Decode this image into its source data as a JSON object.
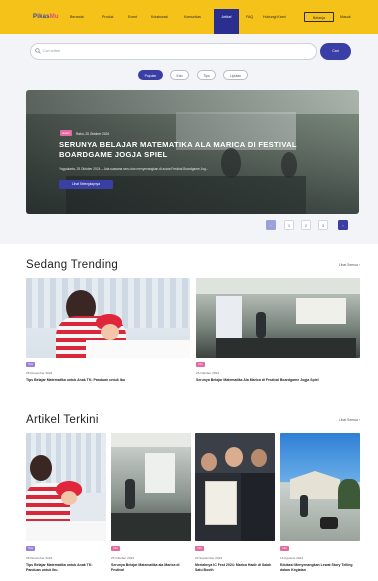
{
  "navbar": {
    "logo_a": "Pikas",
    "logo_b": "Mu",
    "links": [
      "Beranda",
      "Produk",
      "Event",
      "Kolaborasi",
      "Komunitas",
      "Artikel",
      "FAQ",
      "Hubungi Kami",
      "Belanja",
      "Masuk"
    ],
    "active_link": "Artikel",
    "outline_link": "Belanja"
  },
  "search": {
    "placeholder": "Cari artikel",
    "button_label": "Cari"
  },
  "filters": [
    "Populer",
    "Edu",
    "Tips",
    "Liputan"
  ],
  "featured": {
    "category": "Event",
    "date": "Rabu, 25 Oktober 2024",
    "title": "SERUNYA BELAJAR MATEMATIKA ALA MARICA DI FESTIVAL BOARDGAME JOGJA SPIEL",
    "description": "Yogyakarta, 25 Oktober 2024 – Ada suasana seru dan menyenangkan di acara Festival Boardgame Jog...",
    "button_label": "Lihat Selengkapnya"
  },
  "pagination": {
    "prev": "‹",
    "pages": [
      "1",
      "2",
      "3"
    ],
    "next": "›"
  },
  "trending": {
    "title": "Sedang Trending",
    "see_all": "Lihat Semua ›",
    "items": [
      {
        "tag": "Tips",
        "date": "05 Desember 2024",
        "title": "Tips Belajar Matematika untuk Anak TK: Panduan untuk Ibu"
      },
      {
        "tag": "Info",
        "date": "25 Oktober 2024",
        "title": "Serunya Belajar Matematika Ala Marica di Festival Boardgame Jogja Spiel"
      }
    ]
  },
  "latest": {
    "title": "Artikel Terkini",
    "see_all": "Lihat Semua ›",
    "items": [
      {
        "tag": "Tips",
        "date": "05 Desember 2024",
        "title": "Tips Belajar Matematika untuk Anak TK: Panduan untuk Ibu"
      },
      {
        "tag": "Info",
        "date": "25 Oktober 2024",
        "title": "Serunya Belajar Matematika ala Marica di Festival"
      },
      {
        "tag": "Info",
        "date": "20 September 2024",
        "title": "Meriahnya IC Fest 2024: Marica Hadir di Salah Satu Booth"
      },
      {
        "tag": "Info",
        "date": "15 Agustus 2024",
        "title": "Edukasi Menyenangkan Lewat Story Telling dalam Kegiatan"
      }
    ]
  },
  "colors": {
    "navbar": "#f5c21a",
    "primary": "#3a3fa6",
    "tag_pink": "#e56aa0",
    "tag_purple": "#9b7fd6"
  }
}
